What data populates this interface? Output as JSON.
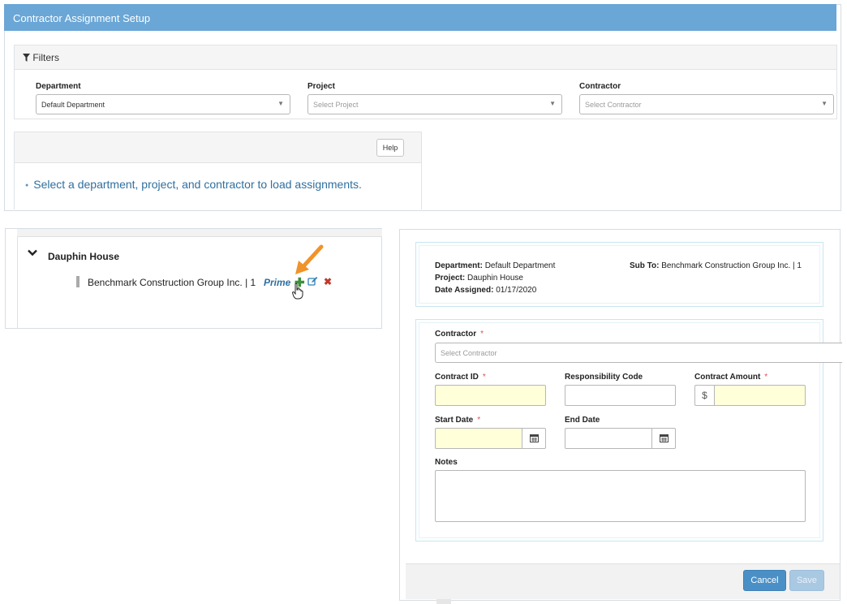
{
  "header": {
    "title": "Contractor Assignment Setup"
  },
  "filters": {
    "title": "Filters",
    "department": {
      "label": "Department",
      "value": "Default Department"
    },
    "project": {
      "label": "Project",
      "placeholder": "Select Project"
    },
    "contractor": {
      "label": "Contractor",
      "placeholder": "Select Contractor"
    }
  },
  "help": {
    "button_label": "Help",
    "message": "Select a department, project, and contractor to load assignments."
  },
  "tree": {
    "node_label": "Dauphin House",
    "item_label": "Benchmark Construction Group Inc. | 1",
    "item_tag": "Prime",
    "icons": {
      "toggle": "chevron-down-icon",
      "add": "plus-icon",
      "edit": "edit-icon",
      "delete": "delete-icon"
    },
    "colors": {
      "add": "#3f8f3f",
      "delete": "#c0392b",
      "callout_arrow": "#f0932b"
    }
  },
  "assignment_info": {
    "department_label": "Department:",
    "department_value": "Default Department",
    "project_label": "Project:",
    "project_value": "Dauphin House",
    "date_label": "Date Assigned:",
    "date_value": "01/17/2020",
    "subto_label": "Sub To:",
    "subto_value": "Benchmark Construction Group Inc. | 1"
  },
  "form": {
    "contractor": {
      "label": "Contractor",
      "required_mark": "*",
      "placeholder": "Select Contractor"
    },
    "contract_id": {
      "label": "Contract ID",
      "required_mark": "*",
      "value": ""
    },
    "responsibility_code": {
      "label": "Responsibility Code",
      "value": ""
    },
    "contract_amount": {
      "label": "Contract Amount",
      "required_mark": "*",
      "prefix": "$",
      "value": ""
    },
    "start_date": {
      "label": "Start Date",
      "required_mark": "*",
      "value": ""
    },
    "end_date": {
      "label": "End Date",
      "value": ""
    },
    "notes": {
      "label": "Notes",
      "value": ""
    }
  },
  "footer": {
    "cancel_label": "Cancel",
    "save_label": "Save"
  },
  "colors": {
    "header": "#6aa6d6",
    "primary_button": "#4a90c6",
    "required_field": "#ffffd9",
    "link": "#2f6f9f"
  }
}
